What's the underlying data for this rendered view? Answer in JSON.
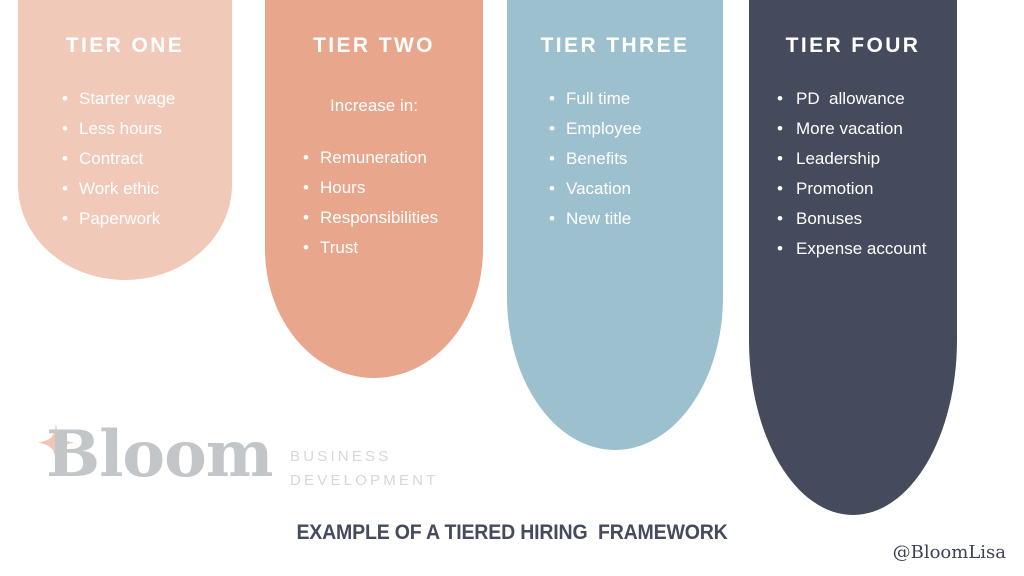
{
  "background_color": "#ffffff",
  "columns": [
    {
      "id": "tier-one",
      "title": "TIER ONE",
      "color": "#f0c9b8",
      "text_color": "#ffffff",
      "subtitle": null,
      "items": [
        "Starter wage",
        "Less hours",
        "Contract",
        "Work ethic",
        "Paperwork"
      ]
    },
    {
      "id": "tier-two",
      "title": "TIER TWO",
      "color": "#e8a68c",
      "text_color": "#ffffff",
      "subtitle": "Increase in:",
      "items": [
        "Remuneration",
        "Hours",
        "Responsibilities",
        "Trust"
      ]
    },
    {
      "id": "tier-three",
      "title": "TIER THREE",
      "color": "#9dc0ce",
      "text_color": "#ffffff",
      "subtitle": null,
      "items": [
        "Full time",
        "Employee",
        "Benefits",
        "Vacation",
        "New title"
      ]
    },
    {
      "id": "tier-four",
      "title": "TIER FOUR",
      "color": "#454b5c",
      "text_color": "#ffffff",
      "subtitle": null,
      "items": [
        "PD  allowance",
        "More vacation",
        "Leadership",
        "Promotion",
        "Bonuses",
        "Expense account"
      ]
    }
  ],
  "logo": {
    "wordmark": "Bloom",
    "wordmark_color": "#c3c6c9",
    "tagline_line1": "BUSINESS",
    "tagline_line2": "DEVELOPMENT",
    "tagline_color": "#d4d7db",
    "sparkle_color": "#f0c5b5"
  },
  "caption": {
    "text": "EXAMPLE OF A TIERED HIRING  FRAMEWORK",
    "color": "#454b5c"
  },
  "handle": {
    "text": "@BloomLisa",
    "color": "#3c4254"
  }
}
